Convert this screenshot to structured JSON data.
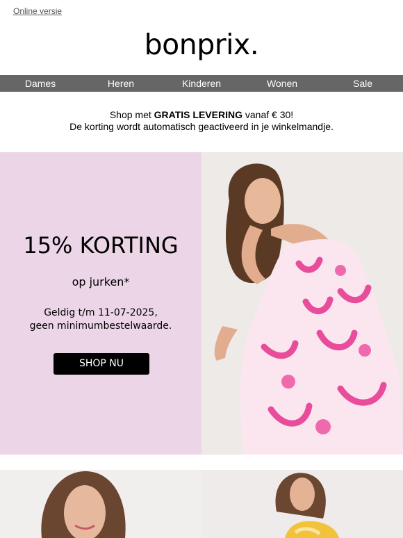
{
  "header": {
    "online_link": "Online versie",
    "logo": "bonprix."
  },
  "nav": {
    "items": [
      "Dames",
      "Heren",
      "Kinderen",
      "Wonen",
      "Sale"
    ]
  },
  "promo": {
    "prefix": "Shop met ",
    "bold": "GRATIS LEVERING",
    "suffix": " vanaf € 30!",
    "line2": "De korting wordt automatisch geactiveerd in je winkelmandje."
  },
  "hero": {
    "title": "15% KORTING",
    "subtitle": "op jurken*",
    "valid_line1": "Geldig t/m 11-07-2025,",
    "valid_line2": "geen minimumbestelwaarde.",
    "button": "SHOP NU",
    "bg_color": "#ecd5e7",
    "image": "woman-pink-dress-photo"
  },
  "products": {
    "left_image": "woman-portrait-photo",
    "right_image": "woman-yellow-dress-photo"
  }
}
